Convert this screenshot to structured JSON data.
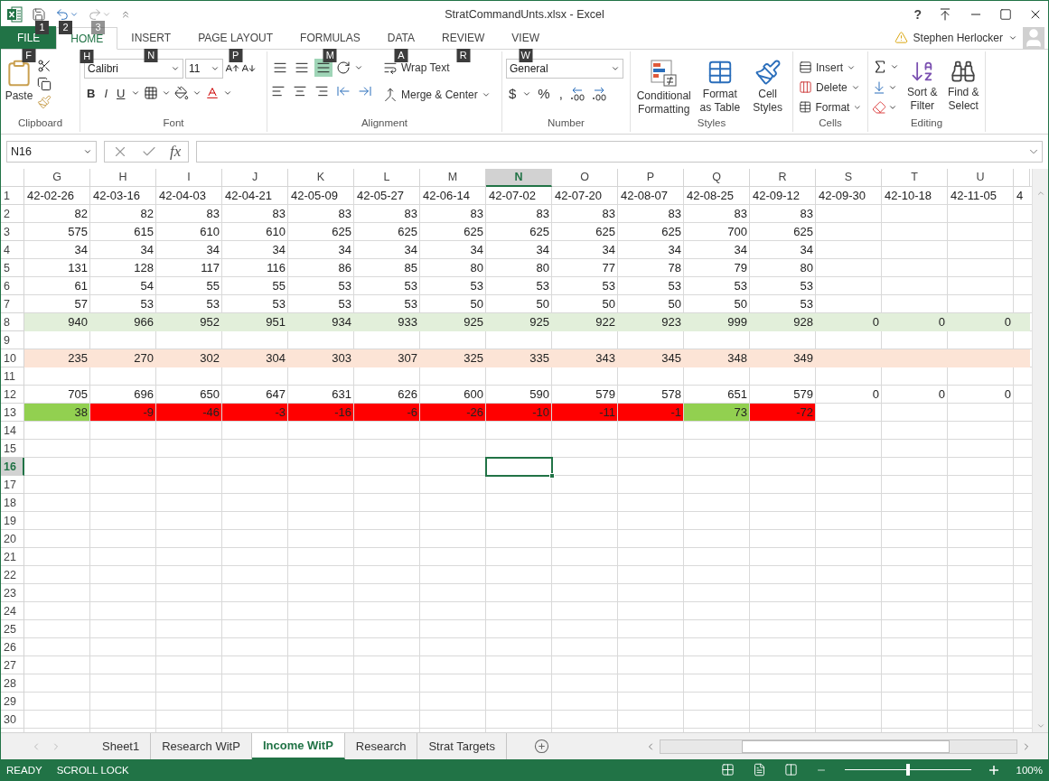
{
  "window": {
    "title": "StratCommandUnts.xlsx - Excel",
    "help": "?"
  },
  "quick_access": {
    "keytips": [
      "1",
      "2",
      "3"
    ]
  },
  "tabs": [
    {
      "label": "FILE",
      "keytip": "F",
      "kind": "file",
      "selected": false
    },
    {
      "label": "HOME",
      "keytip": "H",
      "kind": "tab",
      "selected": true
    },
    {
      "label": "INSERT",
      "keytip": "N",
      "kind": "tab",
      "selected": false
    },
    {
      "label": "PAGE LAYOUT",
      "keytip": "P",
      "kind": "tab",
      "selected": false
    },
    {
      "label": "FORMULAS",
      "keytip": "M",
      "kind": "tab",
      "selected": false
    },
    {
      "label": "DATA",
      "keytip": "A",
      "kind": "tab",
      "selected": false
    },
    {
      "label": "REVIEW",
      "keytip": "R",
      "kind": "tab",
      "selected": false
    },
    {
      "label": "VIEW",
      "keytip": "W",
      "kind": "tab",
      "selected": false
    }
  ],
  "user": {
    "name": "Stephen Herlocker"
  },
  "ribbon": {
    "clipboard": {
      "label": "Clipboard",
      "paste": "Paste"
    },
    "font": {
      "label": "Font",
      "font_name": "Calibri",
      "font_size": "11",
      "bold": "B",
      "italic": "I",
      "underline": "U"
    },
    "alignment": {
      "label": "Alignment",
      "wrap_text": "Wrap Text",
      "merge": "Merge & Center"
    },
    "number": {
      "label": "Number",
      "format": "General",
      "currency": "$",
      "percent": "%",
      "comma": ","
    },
    "styles": {
      "label": "Styles",
      "buttons": [
        "Conditional Formatting",
        "Format as Table",
        "Cell Styles"
      ]
    },
    "cells": {
      "label": "Cells",
      "buttons": [
        "Insert",
        "Delete",
        "Format"
      ]
    },
    "editing": {
      "label": "Editing",
      "buttons": [
        "Sort & Filter",
        "Find & Select"
      ]
    }
  },
  "formula_bar": {
    "name_box": "N16",
    "fx": "fx"
  },
  "columns": [
    {
      "letter": "G",
      "selected": false
    },
    {
      "letter": "H",
      "selected": false
    },
    {
      "letter": "I",
      "selected": false
    },
    {
      "letter": "J",
      "selected": false
    },
    {
      "letter": "K",
      "selected": false
    },
    {
      "letter": "L",
      "selected": false
    },
    {
      "letter": "M",
      "selected": false
    },
    {
      "letter": "N",
      "selected": true
    },
    {
      "letter": "O",
      "selected": false
    },
    {
      "letter": "P",
      "selected": false
    },
    {
      "letter": "Q",
      "selected": false
    },
    {
      "letter": "R",
      "selected": false
    },
    {
      "letter": "S",
      "selected": false
    },
    {
      "letter": "T",
      "selected": false
    },
    {
      "letter": "U",
      "selected": false
    }
  ],
  "rows": [
    {
      "number": "1",
      "selected": false,
      "kind": "text",
      "cells": [
        "42-02-26",
        "42-03-16",
        "42-04-03",
        "42-04-21",
        "42-05-09",
        "42-05-27",
        "42-06-14",
        "42-07-02",
        "42-07-20",
        "42-08-07",
        "42-08-25",
        "42-09-12",
        "42-09-30",
        "42-10-18",
        "42-11-05",
        "4"
      ]
    },
    {
      "number": "2",
      "selected": false,
      "kind": "numbers",
      "cells": [
        "82",
        "82",
        "83",
        "83",
        "83",
        "83",
        "83",
        "83",
        "83",
        "83",
        "83",
        "83"
      ]
    },
    {
      "number": "3",
      "selected": false,
      "kind": "numbers",
      "cells": [
        "575",
        "615",
        "610",
        "610",
        "625",
        "625",
        "625",
        "625",
        "625",
        "625",
        "700",
        "625"
      ]
    },
    {
      "number": "4",
      "selected": false,
      "kind": "numbers",
      "cells": [
        "34",
        "34",
        "34",
        "34",
        "34",
        "34",
        "34",
        "34",
        "34",
        "34",
        "34",
        "34"
      ]
    },
    {
      "number": "5",
      "selected": false,
      "kind": "numbers",
      "cells": [
        "131",
        "128",
        "117",
        "116",
        "86",
        "85",
        "80",
        "80",
        "77",
        "78",
        "79",
        "80"
      ]
    },
    {
      "number": "6",
      "selected": false,
      "kind": "numbers",
      "cells": [
        "61",
        "54",
        "55",
        "55",
        "53",
        "53",
        "53",
        "53",
        "53",
        "53",
        "53",
        "53"
      ]
    },
    {
      "number": "7",
      "selected": false,
      "kind": "numbers",
      "cells": [
        "57",
        "53",
        "53",
        "53",
        "53",
        "53",
        "50",
        "50",
        "50",
        "50",
        "50",
        "53"
      ]
    },
    {
      "number": "8",
      "selected": false,
      "kind": "numbers",
      "color": "#e2efda",
      "cells": [
        "940",
        "966",
        "952",
        "951",
        "934",
        "933",
        "925",
        "925",
        "922",
        "923",
        "999",
        "928",
        "0",
        "0",
        "0"
      ]
    },
    {
      "number": "9",
      "selected": false,
      "kind": "numbers"
    },
    {
      "number": "10",
      "selected": false,
      "kind": "numbers",
      "color": "#fce4d6",
      "cells": [
        "235",
        "270",
        "302",
        "304",
        "303",
        "307",
        "325",
        "335",
        "343",
        "345",
        "348",
        "349"
      ]
    },
    {
      "number": "11",
      "selected": false,
      "kind": "numbers"
    },
    {
      "number": "12",
      "selected": false,
      "kind": "numbers",
      "cells": [
        "705",
        "696",
        "650",
        "647",
        "631",
        "626",
        "600",
        "590",
        "579",
        "578",
        "651",
        "579",
        "0",
        "0",
        "0"
      ]
    },
    {
      "number": "13",
      "selected": false,
      "kind": "numbers",
      "cells": [
        {
          "text": "38",
          "color": "#92d050"
        },
        {
          "text": "-9",
          "color": "#ff0000"
        },
        {
          "text": "-46",
          "color": "#ff0000"
        },
        {
          "text": "-3",
          "color": "#ff0000"
        },
        {
          "text": "-16",
          "color": "#ff0000"
        },
        {
          "text": "-6",
          "color": "#ff0000"
        },
        {
          "text": "-26",
          "color": "#ff0000"
        },
        {
          "text": "-10",
          "color": "#ff0000"
        },
        {
          "text": "-11",
          "color": "#ff0000"
        },
        {
          "text": "-1",
          "color": "#ff0000"
        },
        {
          "text": "73",
          "color": "#92d050"
        },
        {
          "text": "-72",
          "color": "#ff0000"
        }
      ]
    },
    {
      "number": "14",
      "selected": false,
      "kind": "numbers"
    },
    {
      "number": "15",
      "selected": false,
      "kind": "numbers"
    },
    {
      "number": "16",
      "selected": true,
      "kind": "numbers"
    },
    {
      "number": "17",
      "selected": false,
      "kind": "numbers"
    },
    {
      "number": "18",
      "selected": false,
      "kind": "numbers"
    },
    {
      "number": "19",
      "selected": false,
      "kind": "numbers"
    },
    {
      "number": "20",
      "selected": false,
      "kind": "numbers"
    },
    {
      "number": "21",
      "selected": false,
      "kind": "numbers"
    },
    {
      "number": "22",
      "selected": false,
      "kind": "numbers"
    },
    {
      "number": "23",
      "selected": false,
      "kind": "numbers"
    },
    {
      "number": "24",
      "selected": false,
      "kind": "numbers"
    },
    {
      "number": "25",
      "selected": false,
      "kind": "numbers"
    },
    {
      "number": "26",
      "selected": false,
      "kind": "numbers"
    },
    {
      "number": "27",
      "selected": false,
      "kind": "numbers"
    },
    {
      "number": "28",
      "selected": false,
      "kind": "numbers"
    },
    {
      "number": "29",
      "selected": false,
      "kind": "numbers"
    },
    {
      "number": "30",
      "selected": false,
      "kind": "numbers"
    }
  ],
  "sheet_tabs": [
    {
      "label": "Sheet1",
      "selected": false
    },
    {
      "label": "Research WitP",
      "selected": false
    },
    {
      "label": "Income WitP",
      "selected": true
    },
    {
      "label": "Research",
      "selected": false
    },
    {
      "label": "Strat Targets",
      "selected": false
    }
  ],
  "status_bar": {
    "mode": "READY",
    "scroll_lock": "SCROLL LOCK",
    "zoom": "100%",
    "zoom_slider": {
      "level": 0.5
    }
  }
}
